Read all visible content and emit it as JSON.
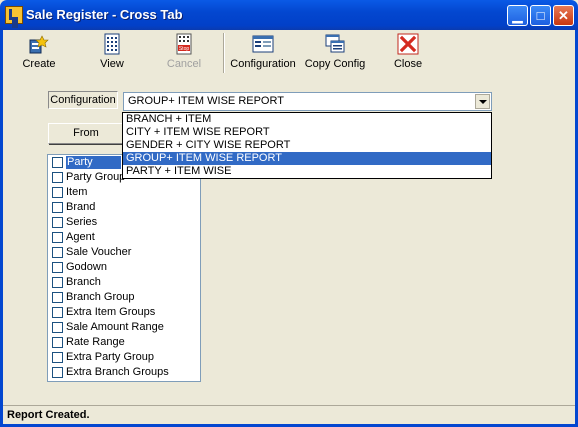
{
  "window": {
    "title": "Sale Register - Cross Tab"
  },
  "toolbar": {
    "create": "Create",
    "view": "View",
    "cancel": "Cancel",
    "configuration": "Configuration",
    "copy_config": "Copy Config",
    "close": "Close"
  },
  "configuration": {
    "label": "Configuration",
    "selected": "GROUP+ ITEM WISE REPORT",
    "options": [
      "BRANCH + ITEM",
      "CITY + ITEM WISE REPORT",
      "GENDER + CITY WISE REPORT",
      "GROUP+ ITEM WISE REPORT",
      "PARTY + ITEM WISE"
    ]
  },
  "from_button": "From",
  "fields": [
    "Party",
    "Party Group",
    "Item",
    "Brand",
    "Series",
    "Agent",
    "Sale Voucher",
    "Godown",
    "Branch",
    "Branch Group",
    "Extra Item Groups",
    "Sale Amount Range",
    "Rate Range",
    "Extra Party Group",
    "Extra Branch Groups"
  ],
  "status": "Report Created.",
  "icons": {
    "create": "create-icon",
    "view": "view-icon",
    "cancel": "stop-icon",
    "configuration": "configuration-icon",
    "copy_config": "copy-config-icon",
    "close": "close-icon"
  }
}
